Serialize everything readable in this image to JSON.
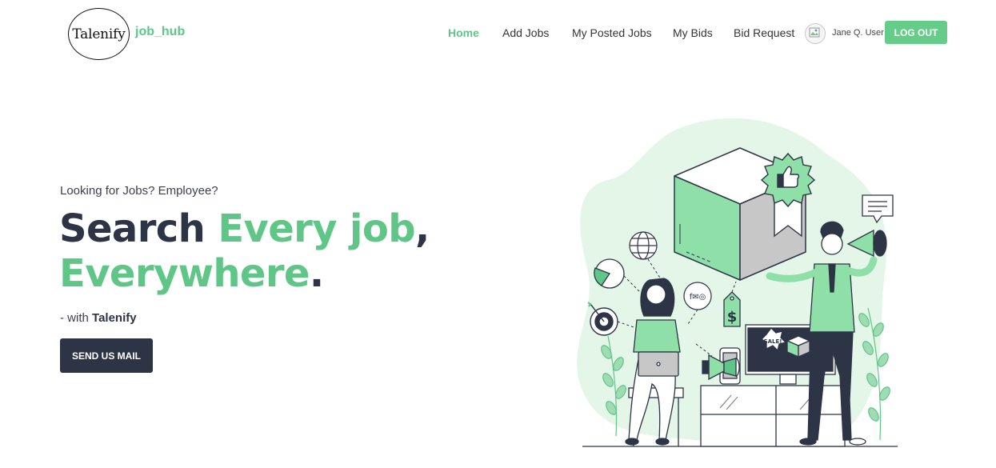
{
  "header": {
    "logo_text": "Talenify",
    "brand": "job_hub",
    "nav": [
      {
        "label": "Home",
        "active": true
      },
      {
        "label": "Add Jobs",
        "active": false
      },
      {
        "label": "My Posted Jobs",
        "active": false
      },
      {
        "label": "My Bids",
        "active": false
      },
      {
        "label": "Bid Request",
        "active": false
      }
    ],
    "user_name": "Jane Q. User",
    "logout_label": "LOG OUT"
  },
  "hero": {
    "eyebrow": "Looking for Jobs? Employee?",
    "headline": {
      "part1": "Search ",
      "part2": "Every job",
      "part3": ",",
      "part4": "Everywhere",
      "part5": "."
    },
    "tagline_prefix": "- with ",
    "tagline_brand": "Talenify",
    "cta_label": "SEND US MAIL"
  },
  "illustration": {
    "sale_label": "SALE!",
    "price_symbol": "$",
    "social_icons": "f✉◎"
  },
  "colors": {
    "accent": "#5fc687",
    "dark": "#2d3446",
    "blob": "#e3f6e8"
  }
}
